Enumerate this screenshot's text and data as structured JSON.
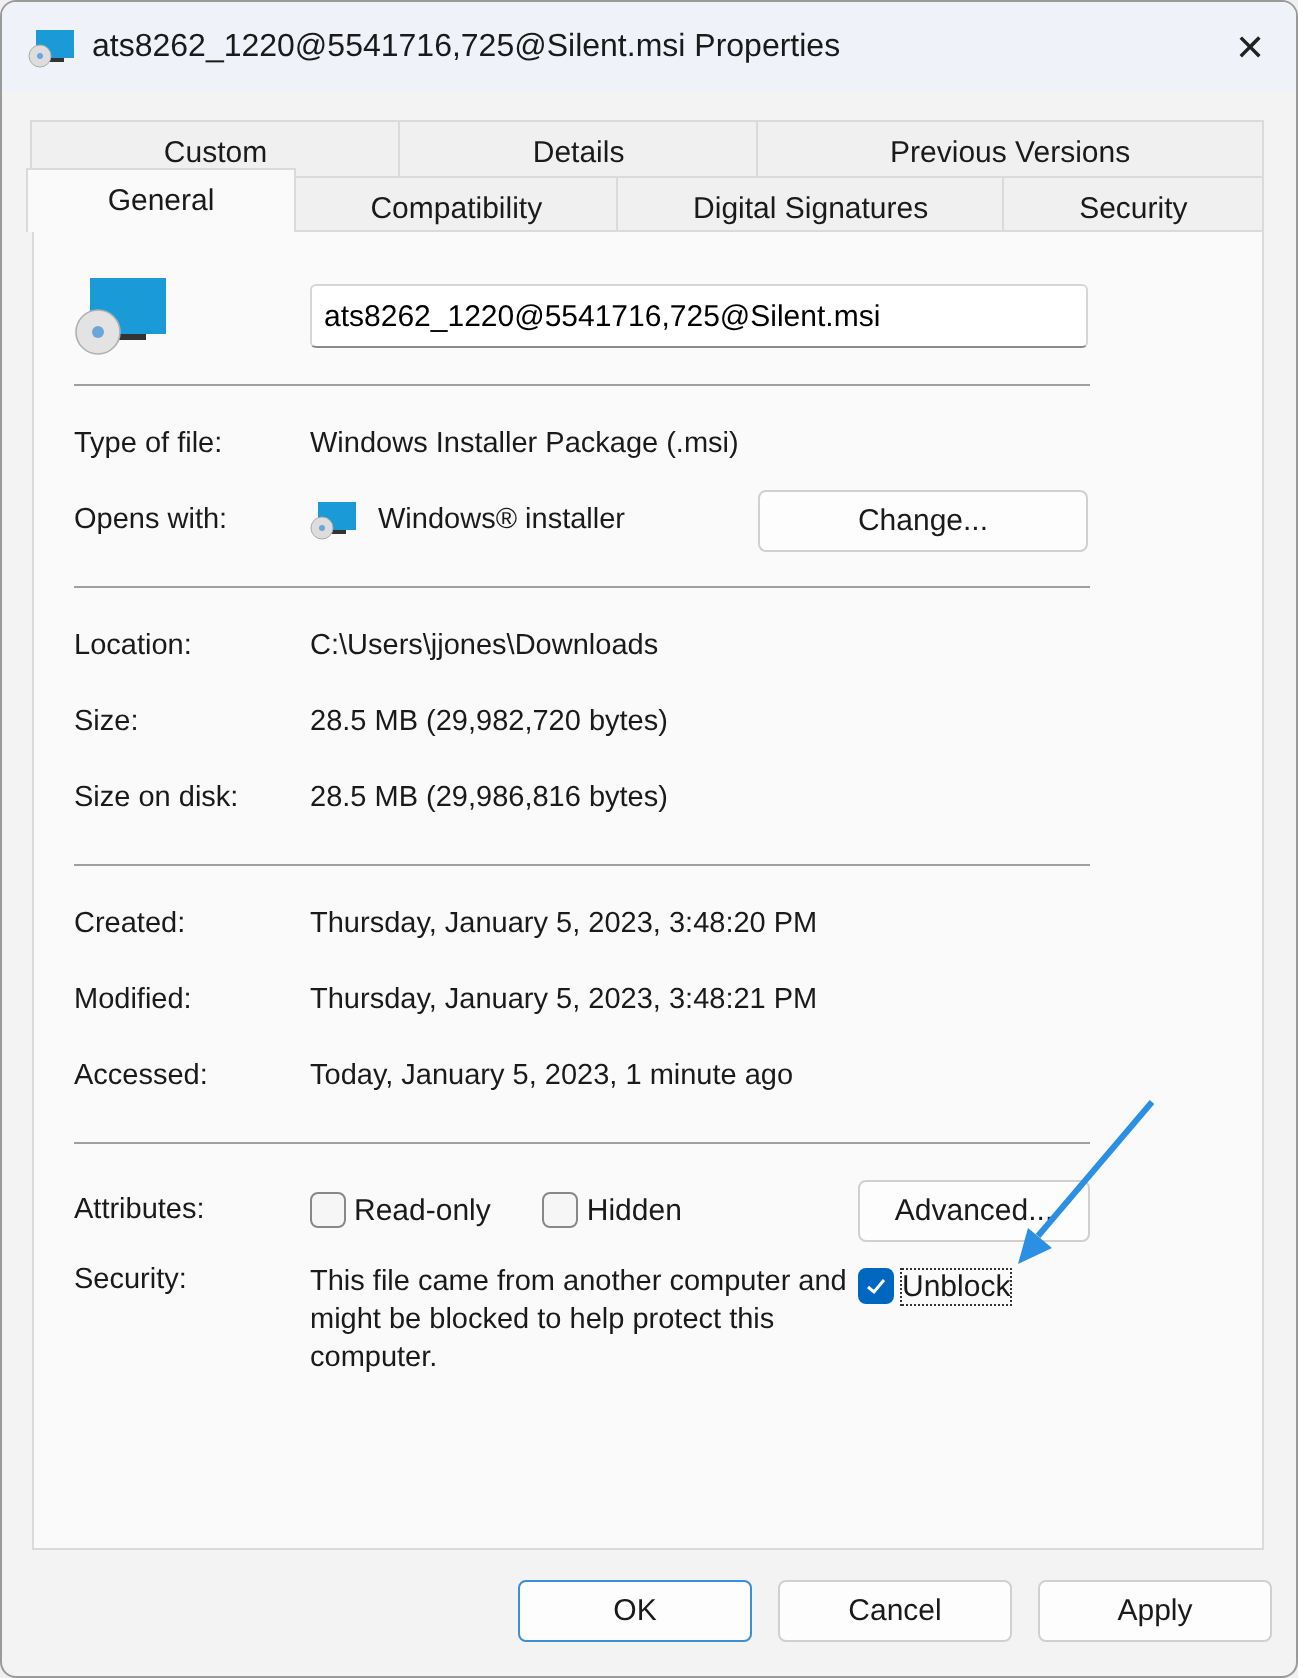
{
  "window": {
    "title": "ats8262_1220@5541716,725@Silent.msi Properties",
    "close": "✕"
  },
  "tab_rows": [
    {
      "tabs": [
        {
          "label": "Custom",
          "selected": false
        },
        {
          "label": "Details",
          "selected": false
        },
        {
          "label": "Previous Versions",
          "selected": false
        }
      ]
    },
    {
      "tabs": [
        {
          "label": "General",
          "selected": true
        },
        {
          "label": "Compatibility",
          "selected": false
        },
        {
          "label": "Digital Signatures",
          "selected": false
        },
        {
          "label": "Security",
          "selected": false
        }
      ]
    }
  ],
  "file_name": {
    "value": "ats8262_1220@5541716,725@Silent.msi"
  },
  "sections": [
    {
      "rows": [
        {
          "kind": "text",
          "label": "Type of file:",
          "value": "Windows Installer Package (.msi)"
        },
        {
          "kind": "app",
          "label": "Opens with:",
          "value": "Windows® installer",
          "button": "Change..."
        }
      ]
    },
    {
      "rows": [
        {
          "kind": "text",
          "label": "Location:",
          "value": "C:\\Users\\jjones\\Downloads"
        },
        {
          "kind": "text",
          "label": "Size:",
          "value": "28.5 MB (29,982,720 bytes)"
        },
        {
          "kind": "text",
          "label": "Size on disk:",
          "value": "28.5 MB (29,986,816 bytes)"
        }
      ]
    },
    {
      "rows": [
        {
          "kind": "text",
          "label": "Created:",
          "value": "Thursday, January 5, 2023, 3:48:20 PM"
        },
        {
          "kind": "text",
          "label": "Modified:",
          "value": "Thursday, January 5, 2023, 3:48:21 PM"
        },
        {
          "kind": "text",
          "label": "Accessed:",
          "value": "Today, January 5, 2023, 1 minute ago"
        }
      ]
    }
  ],
  "attributes": {
    "label": "Attributes:",
    "checkboxes": [
      {
        "label": "Read-only",
        "checked": false
      },
      {
        "label": "Hidden",
        "checked": false
      }
    ],
    "button": "Advanced..."
  },
  "security": {
    "label": "Security:",
    "text": "This file came from another computer and might be blocked to help protect this computer.",
    "checkbox": {
      "label": "Unblock",
      "checked": true
    }
  },
  "buttons": [
    {
      "label": "OK",
      "default": true
    },
    {
      "label": "Cancel",
      "default": false
    },
    {
      "label": "Apply",
      "default": false
    }
  ]
}
